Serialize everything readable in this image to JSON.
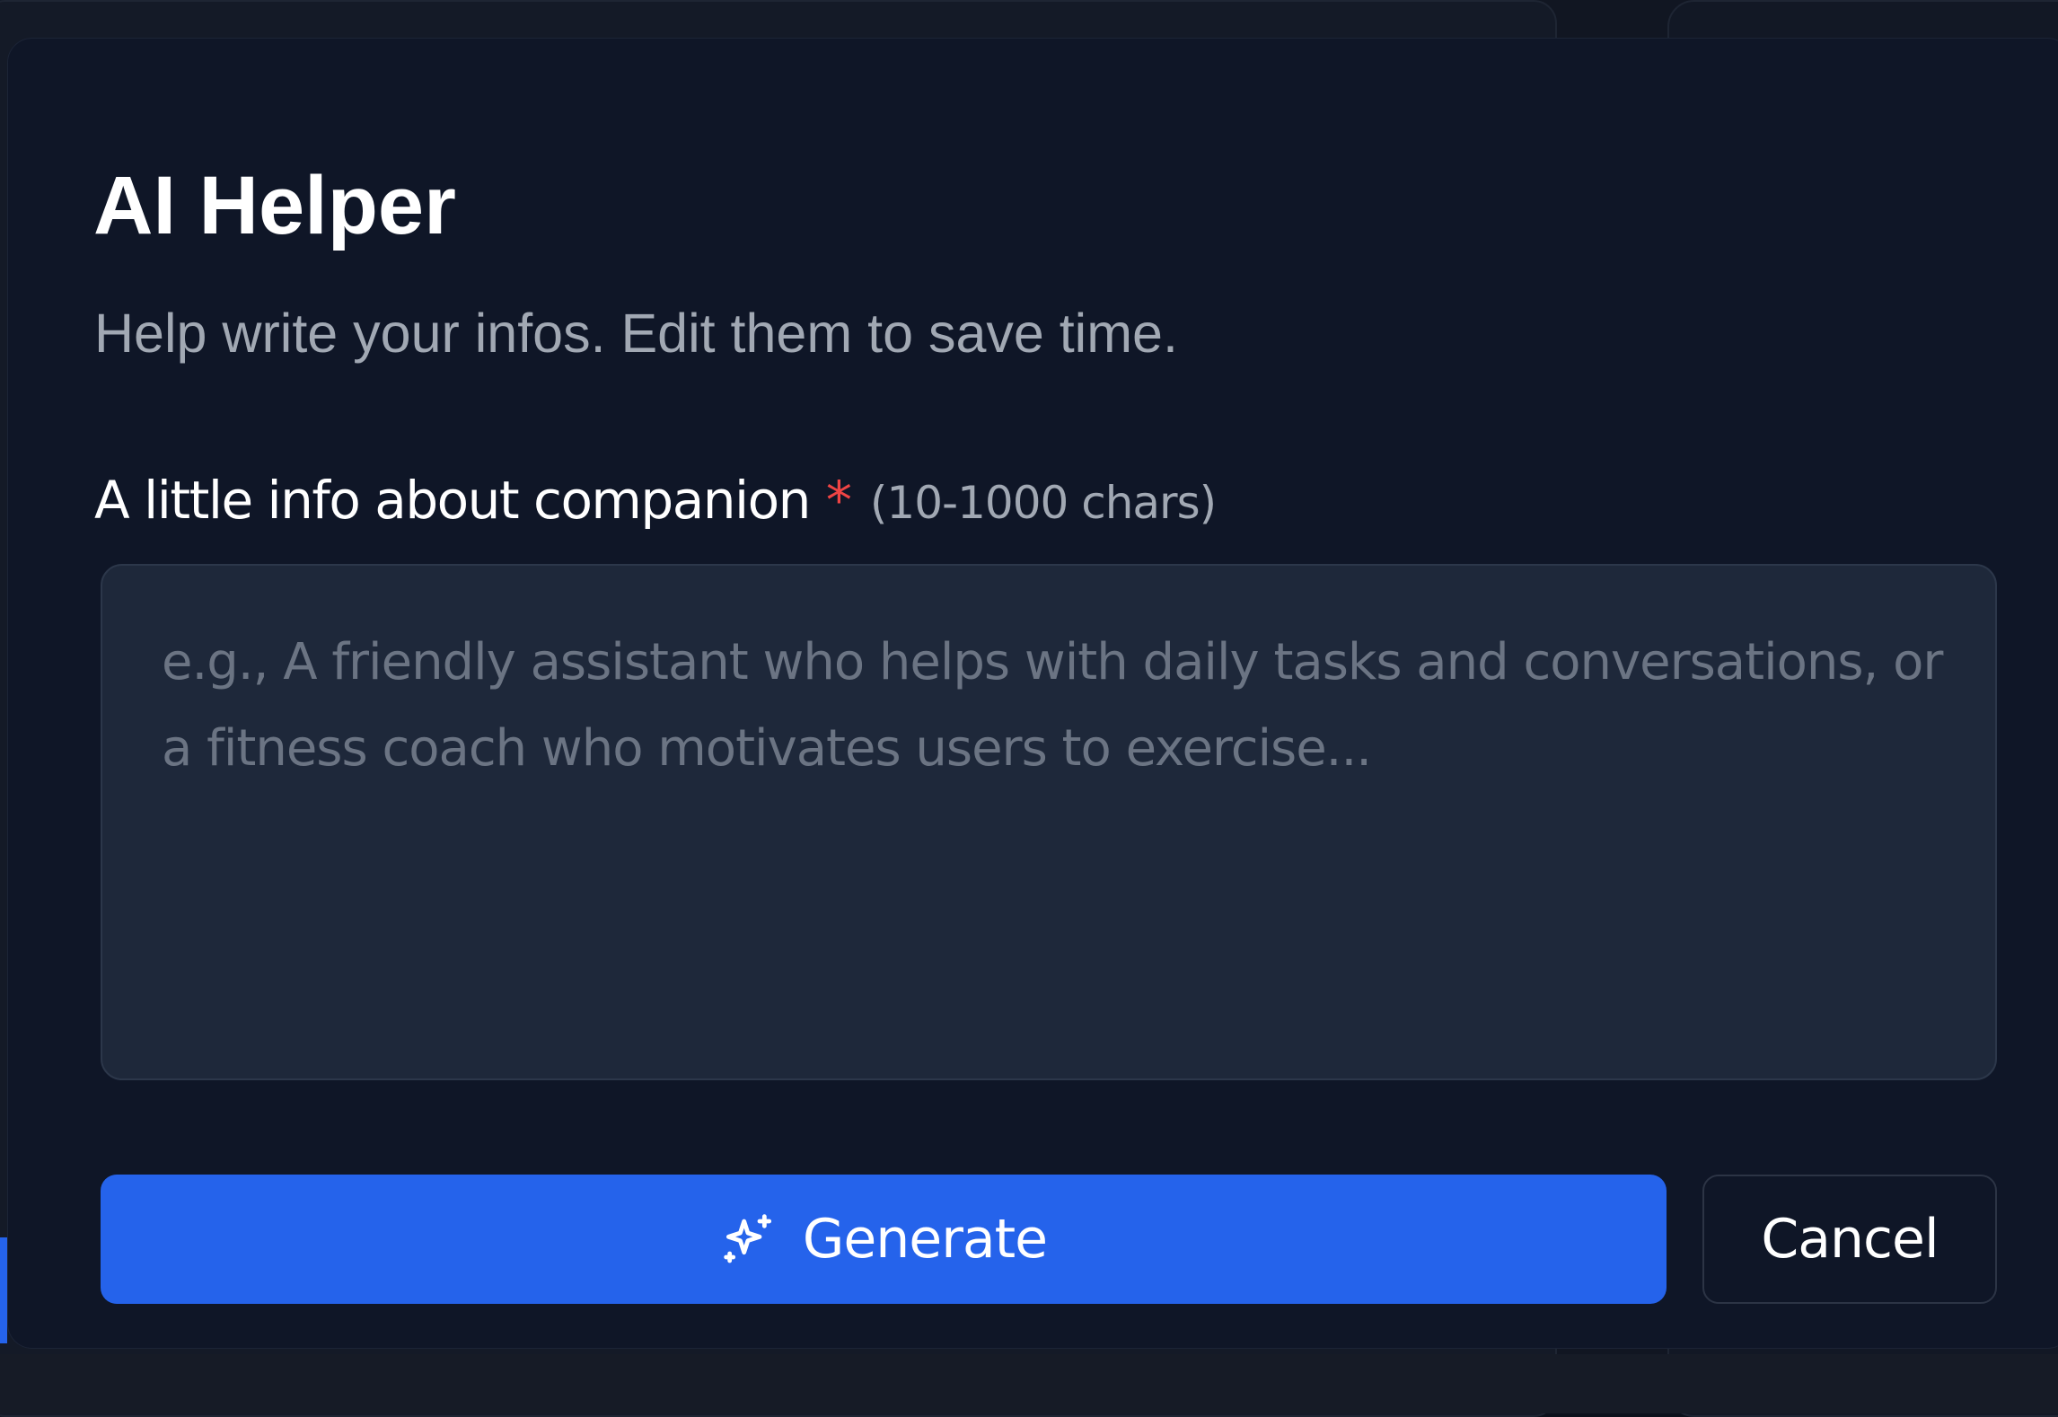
{
  "dialog": {
    "title": "AI Helper",
    "subtitle": "Help write your infos. Edit them to save time.",
    "field": {
      "label": "A little info about companion",
      "required_mark": "*",
      "hint": "(10-1000 chars)",
      "value": "",
      "placeholder": "e.g., A friendly assistant who helps with daily tasks and conversations, or a fitness coach who motivates users to exercise..."
    },
    "actions": {
      "generate_label": "Generate",
      "generate_icon": "sparkle-icon",
      "cancel_label": "Cancel"
    }
  },
  "colors": {
    "primary": "#2563eb",
    "required": "#ef4444",
    "dialog_background": "#0f1627",
    "input_background": "#1e283a"
  }
}
